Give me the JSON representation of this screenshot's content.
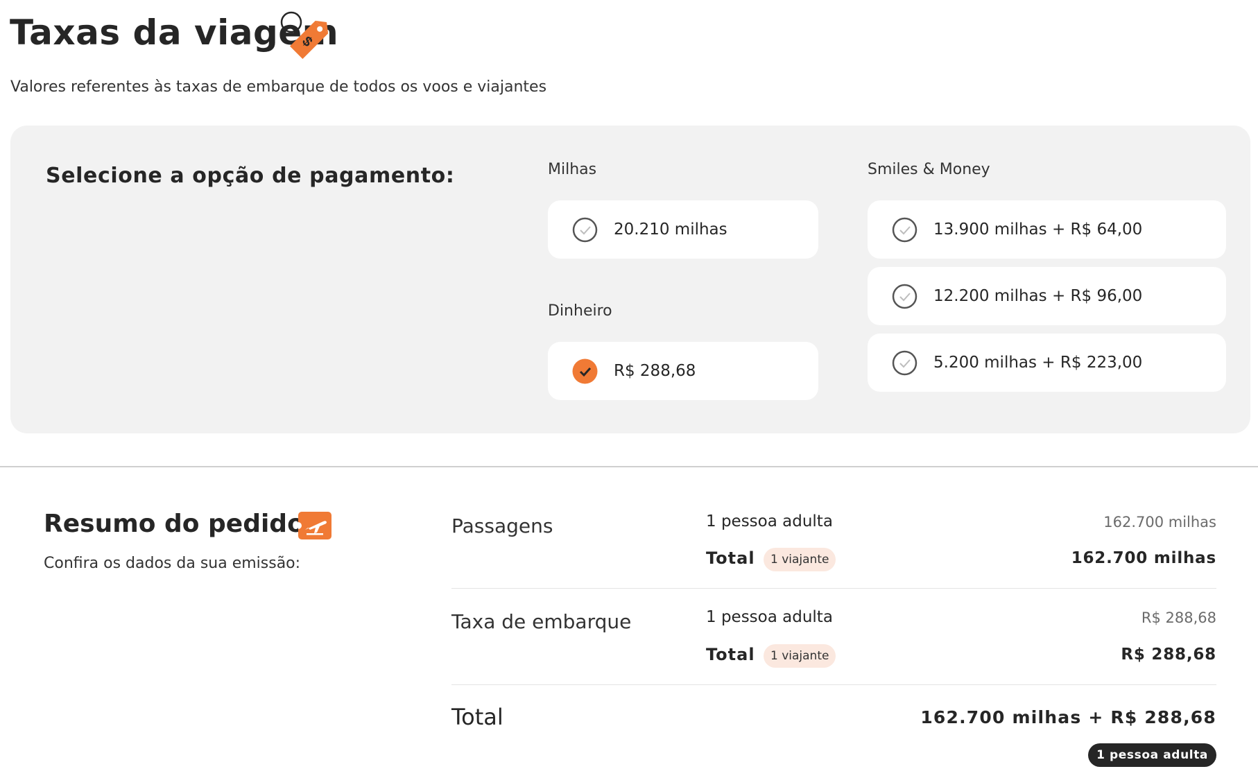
{
  "header": {
    "title": "Taxas da viagem",
    "subtitle": "Valores referentes às taxas de embarque de todos os voos e viajantes"
  },
  "payment": {
    "heading": "Selecione a opção de pagamento:",
    "groups": {
      "milhas": {
        "label": "Milhas",
        "options": [
          {
            "text": "20.210 milhas",
            "selected": false
          }
        ]
      },
      "dinheiro": {
        "label": "Dinheiro",
        "options": [
          {
            "text": "R$ 288,68",
            "selected": true
          }
        ]
      },
      "smiles_money": {
        "label": "Smiles & Money",
        "options": [
          {
            "text": "13.900 milhas + R$ 64,00",
            "selected": false
          },
          {
            "text": "12.200 milhas + R$ 96,00",
            "selected": false
          },
          {
            "text": "5.200 milhas + R$ 223,00",
            "selected": false
          }
        ]
      }
    }
  },
  "summary": {
    "title": "Resumo do pedido",
    "subtitle": "Confira os dados da sua emissão:",
    "rows": [
      {
        "label": "Passagens",
        "desc": "1 pessoa adulta",
        "value": "162.700 milhas",
        "total_label": "Total",
        "badge": "1 viajante",
        "total_value": "162.700 milhas"
      },
      {
        "label": "Taxa de embarque",
        "desc": "1 pessoa adulta",
        "value": "R$ 288,68",
        "total_label": "Total",
        "badge": "1 viajante",
        "total_value": "R$ 288,68"
      }
    ],
    "grand_total": {
      "label": "Total",
      "value": "162.700 milhas + R$ 288,68",
      "pill": "1 pessoa adulta"
    }
  },
  "colors": {
    "accent": "#f07a35",
    "panel_bg": "#f2f2f2",
    "badge_bg": "#fbe8df",
    "text_dark": "#262626"
  },
  "icons": {
    "title_icon": "price-tag-icon",
    "summary_icon": "plane-takeoff-icon",
    "radio_unselected": "check-circle-outline-icon",
    "radio_selected": "check-circle-filled-icon"
  }
}
